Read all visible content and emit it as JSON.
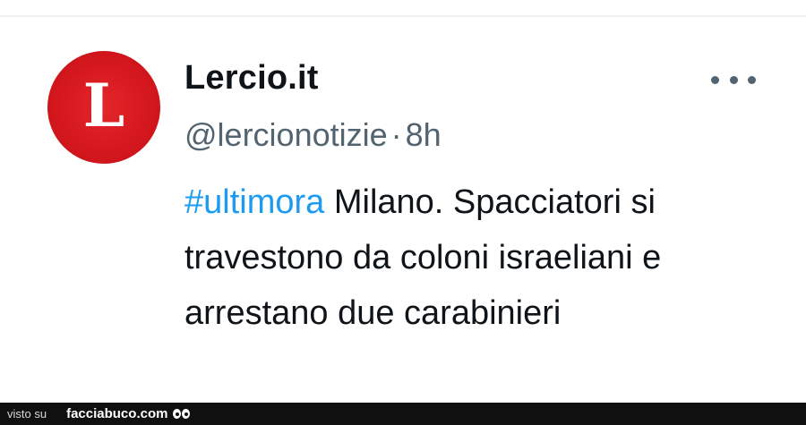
{
  "tweet": {
    "avatar_letter": "L",
    "display_name": "Lercio.it",
    "handle": "@lercionotizie",
    "separator": "·",
    "time": "8h",
    "hashtag": "#ultimora",
    "text": " Milano. Spacciatori si travestono da coloni israeliani e arrestano due carabinieri",
    "more_icon": "more-horizontal-icon"
  },
  "footer": {
    "prefix": "visto su",
    "brand": "facciabuco.com",
    "logo_icon": "eyes-icon"
  },
  "colors": {
    "text_primary": "#0f1419",
    "text_secondary": "#536471",
    "hashtag": "#1d9bf0",
    "avatar_red": "#d3171d",
    "footer_bg": "#101010"
  }
}
